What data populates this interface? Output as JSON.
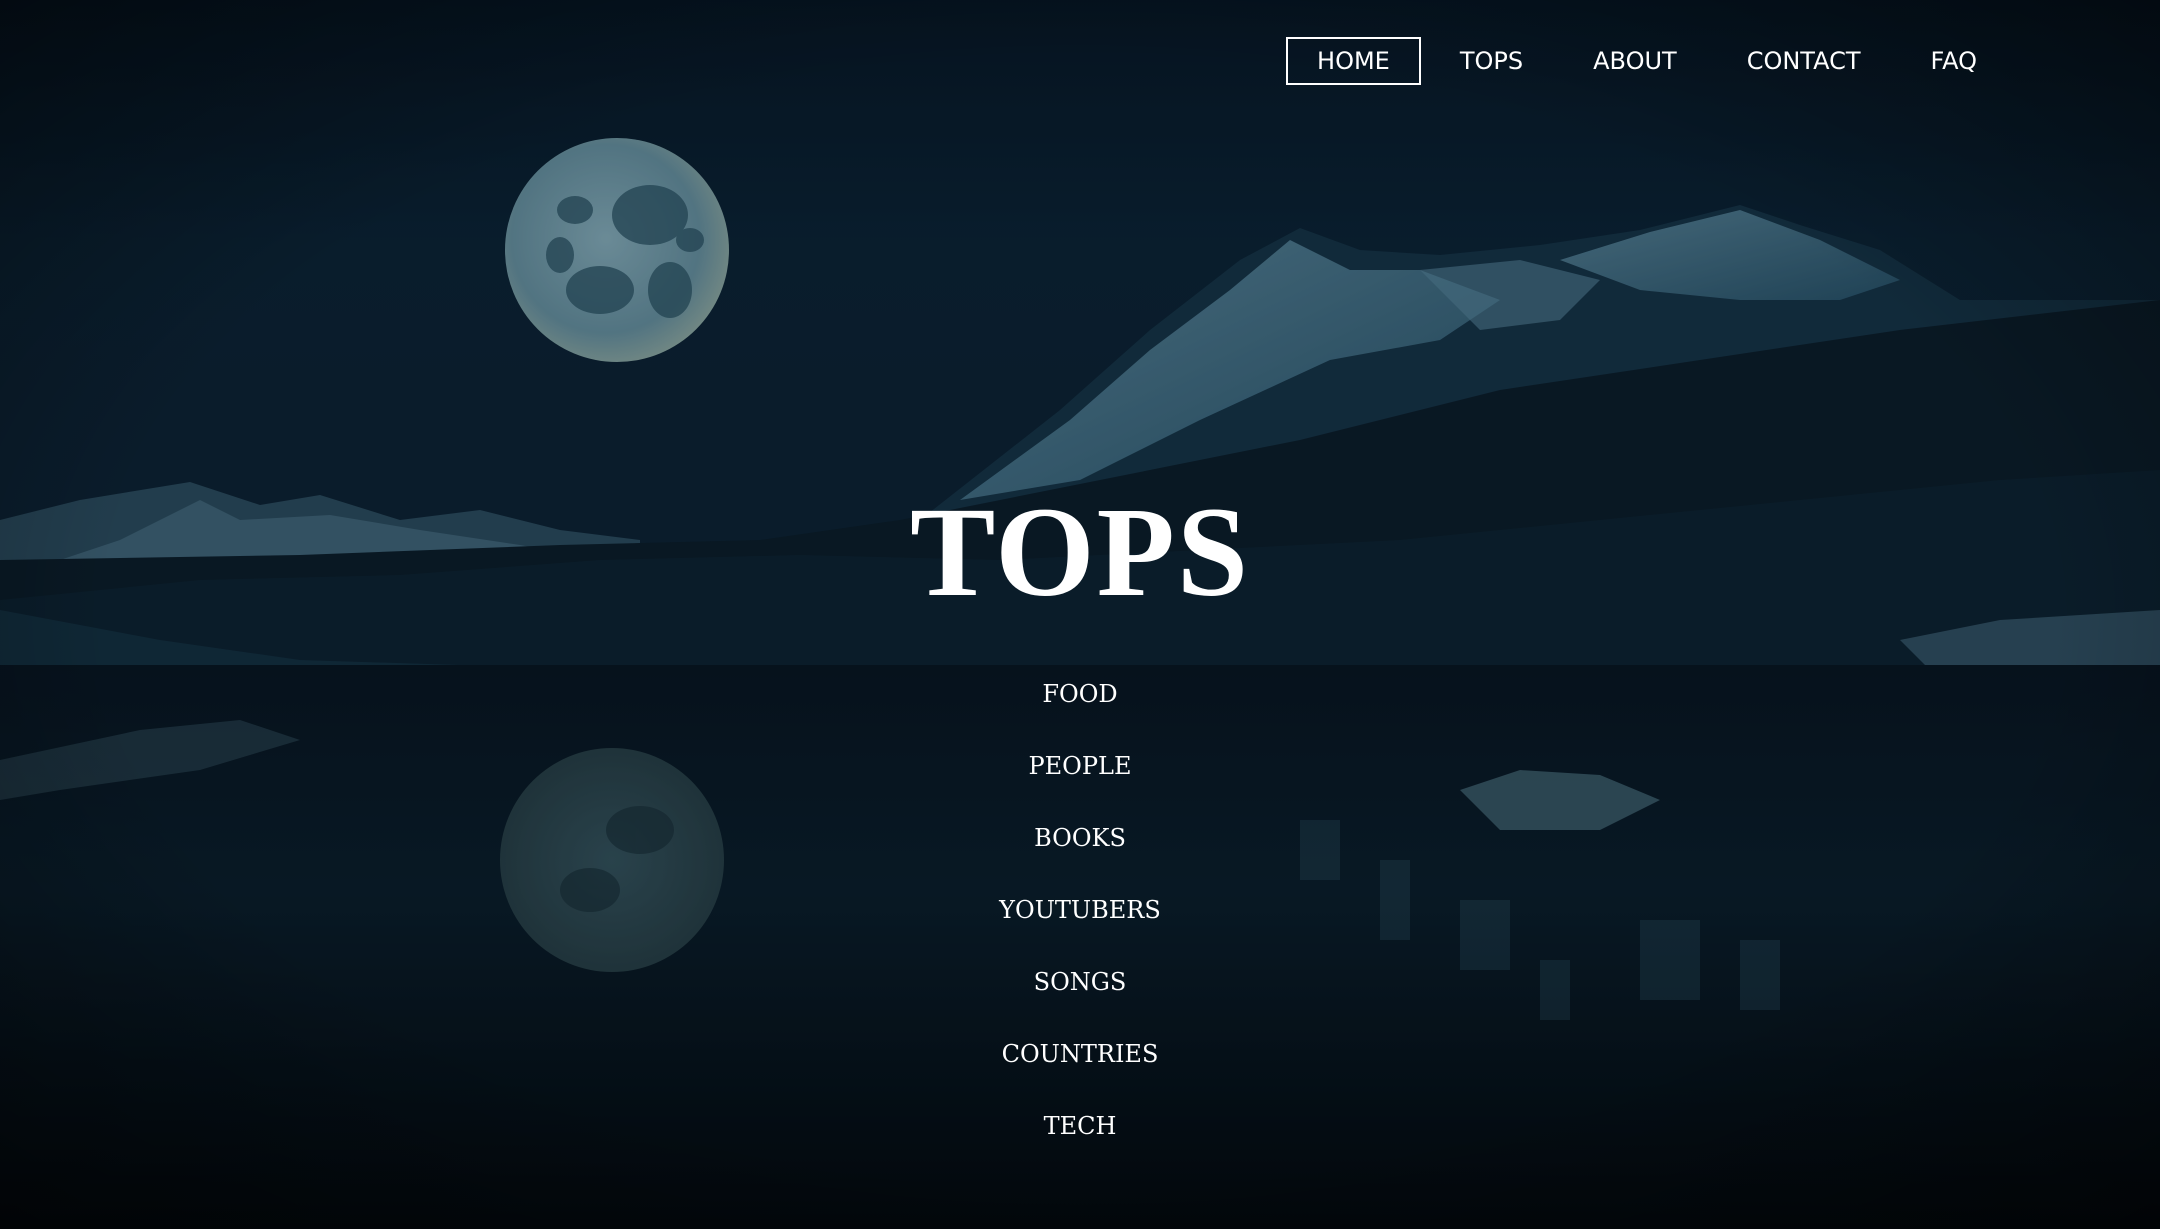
{
  "nav": {
    "items": [
      {
        "label": "HOME",
        "active": true
      },
      {
        "label": "TOPS"
      },
      {
        "label": "ABOUT"
      },
      {
        "label": "CONTACT"
      },
      {
        "label": "FAQ"
      }
    ]
  },
  "hero": {
    "title": "TOPS"
  },
  "categories": [
    {
      "label": "FOOD"
    },
    {
      "label": "PEOPLE"
    },
    {
      "label": "BOOKS"
    },
    {
      "label": "YOUTUBERS"
    },
    {
      "label": "SONGS"
    },
    {
      "label": "COUNTRIES"
    },
    {
      "label": "TECH"
    }
  ],
  "colors": {
    "sky": "#0a1d2c",
    "water": "#040d15",
    "moon": "#7fa6b3",
    "snow": "#5f8fa6",
    "text": "#ffffff"
  }
}
